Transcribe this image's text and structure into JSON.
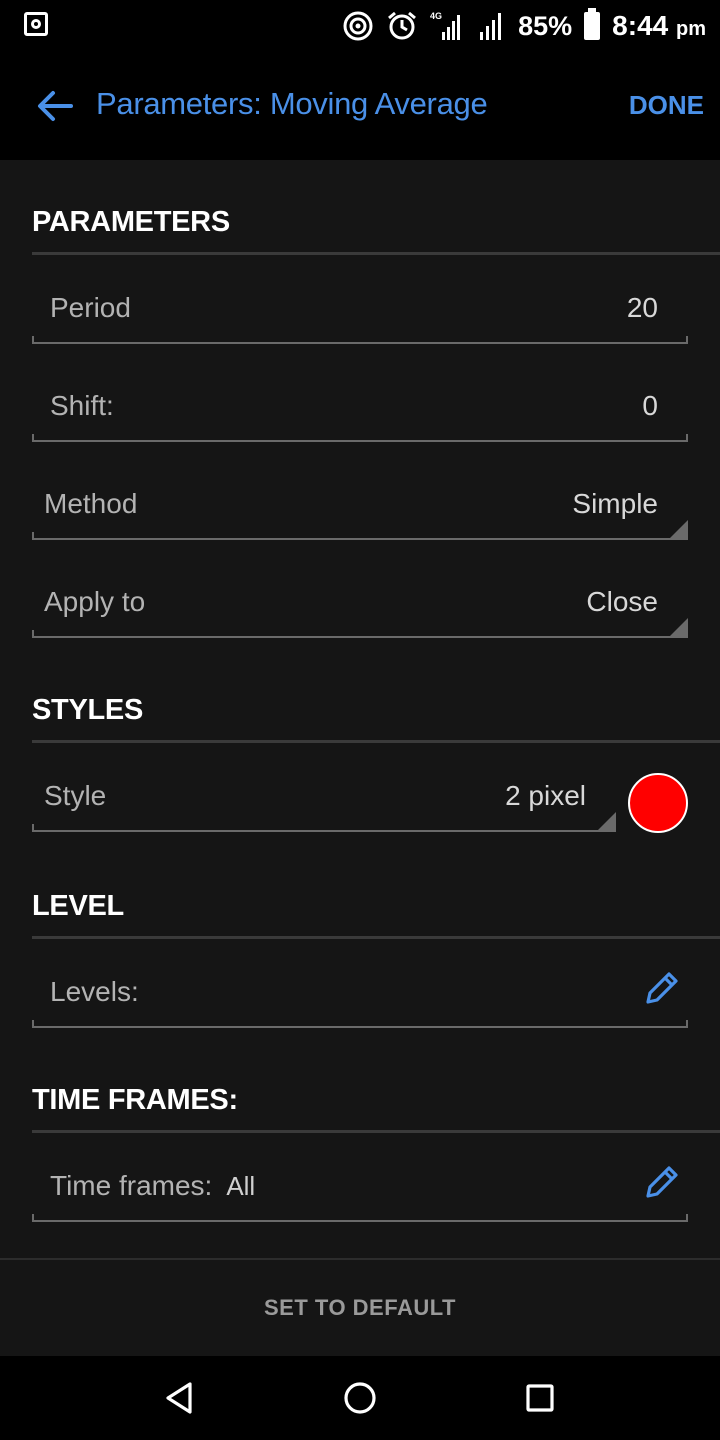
{
  "status_bar": {
    "battery": "85%",
    "time": "8:44",
    "ampm": "pm",
    "network": "4G"
  },
  "app_bar": {
    "title": "Parameters: Moving Average",
    "done": "DONE"
  },
  "sections": {
    "parameters": {
      "title": "PARAMETERS",
      "period": {
        "label": "Period",
        "value": "20"
      },
      "shift": {
        "label": "Shift:",
        "value": "0"
      },
      "method": {
        "label": "Method",
        "value": "Simple"
      },
      "apply_to": {
        "label": "Apply to",
        "value": "Close"
      }
    },
    "styles": {
      "title": "STYLES",
      "style": {
        "label": "Style",
        "value": "2 pixel"
      },
      "color": "#ff0000"
    },
    "level": {
      "title": "LEVEL",
      "levels": {
        "label": "Levels:"
      }
    },
    "time_frames": {
      "title": "TIME FRAMES:",
      "time_frames": {
        "label": "Time frames:",
        "value": "All"
      }
    }
  },
  "footer": {
    "set_default": "SET TO DEFAULT"
  },
  "colors": {
    "accent": "#4a90e8",
    "background": "#151515",
    "swatch": "#ff0000"
  },
  "icons": [
    "back-arrow-icon",
    "pencil-icon",
    "nav-back-icon",
    "nav-home-icon",
    "nav-recents-icon"
  ]
}
